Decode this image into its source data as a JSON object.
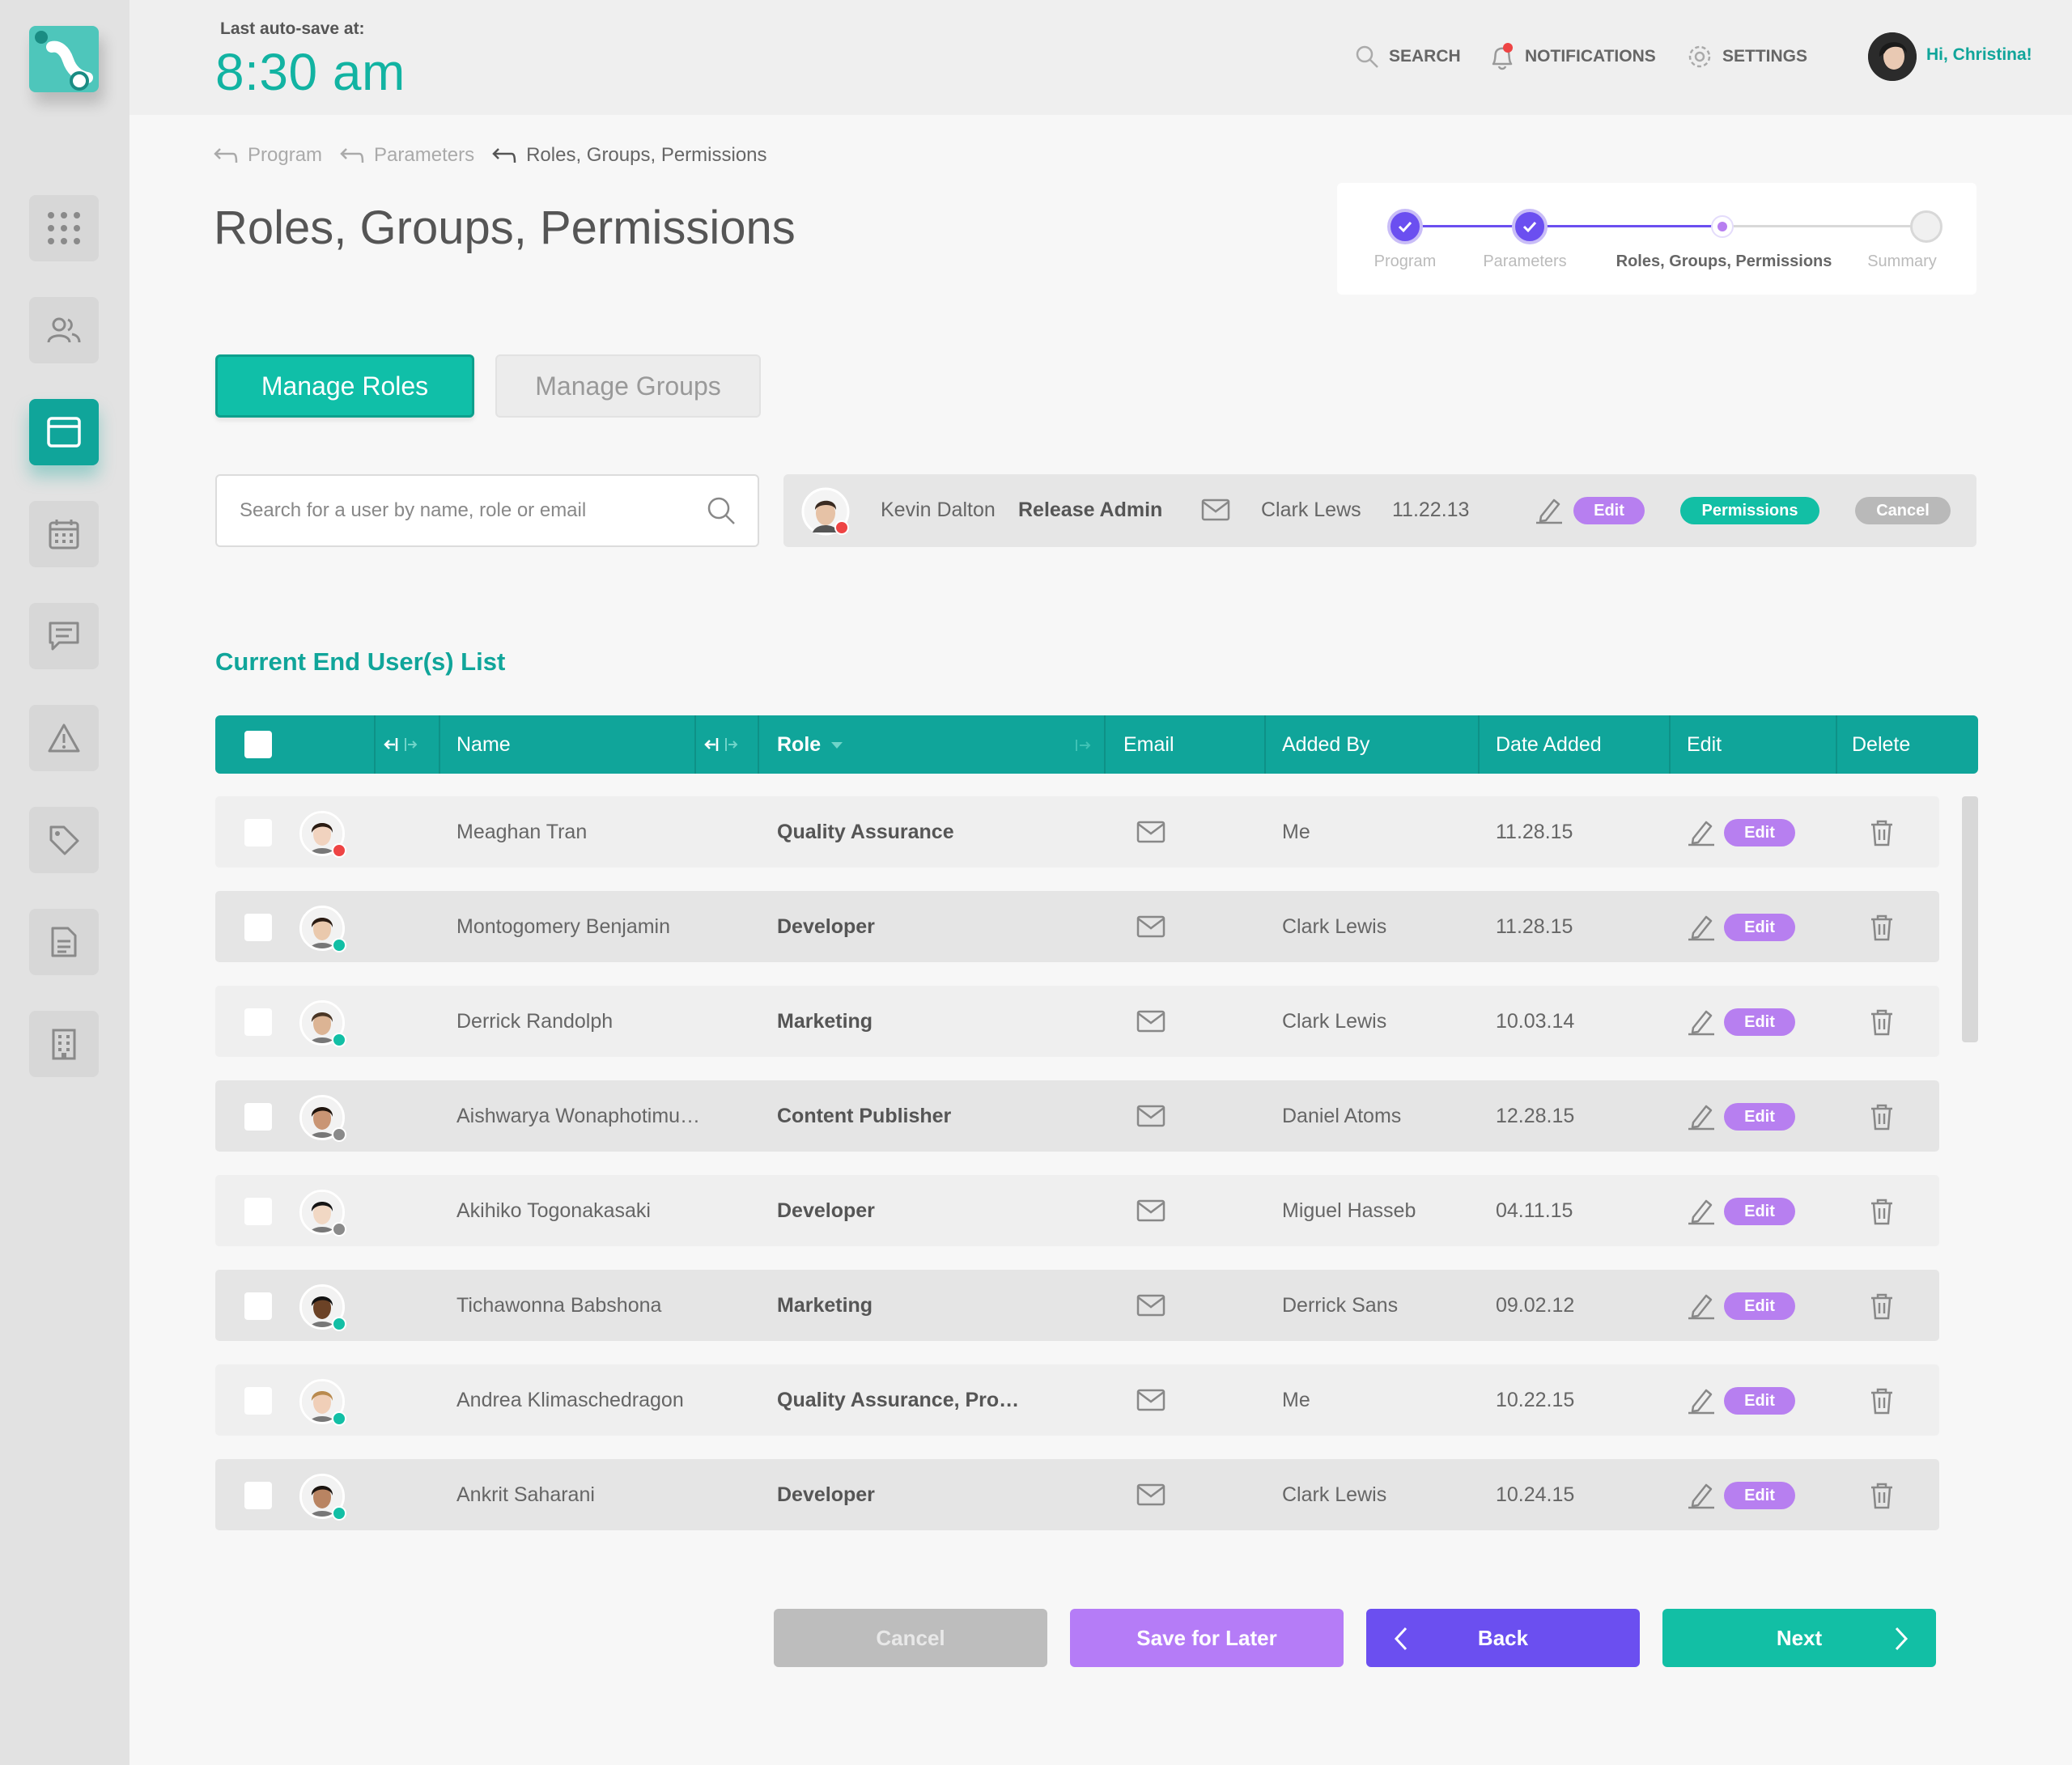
{
  "autosave": {
    "label": "Last auto-save at:",
    "time": "8:30 am"
  },
  "topnav": {
    "search": "SEARCH",
    "notifications": "NOTIFICATIONS",
    "settings": "SETTINGS",
    "greeting": "Hi, Christina!"
  },
  "sidebar": {
    "items": [
      {
        "icon": "grid-icon"
      },
      {
        "icon": "users-icon"
      },
      {
        "icon": "window-icon",
        "active": true
      },
      {
        "icon": "calendar-icon"
      },
      {
        "icon": "chat-icon"
      },
      {
        "icon": "warning-icon"
      },
      {
        "icon": "tag-icon"
      },
      {
        "icon": "document-icon"
      },
      {
        "icon": "building-icon"
      }
    ]
  },
  "breadcrumb": [
    "Program",
    "Parameters",
    "Roles, Groups, Permissions"
  ],
  "page_title": "Roles, Groups, Permissions",
  "stepper": {
    "steps": [
      "Program",
      "Parameters",
      "Roles, Groups, Permissions",
      "Summary"
    ],
    "current_index": 2
  },
  "tabs": {
    "active": "Manage Roles",
    "inactive": "Manage Groups"
  },
  "search": {
    "placeholder": "Search for a user by name, role or email"
  },
  "selected_user": {
    "name": "Kevin Dalton",
    "role": "Release Admin",
    "added_by": "Clark Lews",
    "date": "11.22.13",
    "edit_label": "Edit",
    "permissions_label": "Permissions",
    "cancel_label": "Cancel"
  },
  "section_title": "Current End User(s) List",
  "table": {
    "columns": [
      "Name",
      "Role",
      "Email",
      "Added By",
      "Date Added",
      "Edit",
      "Delete"
    ],
    "edit_label": "Edit",
    "rows": [
      {
        "name": "Meaghan Tran",
        "role": "Quality Assurance",
        "added_by": "Me",
        "date": "11.28.15",
        "status": "#ee4444"
      },
      {
        "name": "Montogomery Benjamin",
        "role": "Developer",
        "added_by": "Clark Lewis",
        "date": "11.28.15",
        "status": "#12bfa5"
      },
      {
        "name": "Derrick Randolph",
        "role": "Marketing",
        "added_by": "Clark Lewis",
        "date": "10.03.14",
        "status": "#12bfa5"
      },
      {
        "name": "Aishwarya Wonaphotimu…",
        "role": "Content Publisher",
        "added_by": "Daniel Atoms",
        "date": "12.28.15",
        "status": "#8a8a8a"
      },
      {
        "name": "Akihiko Togonakasaki",
        "role": "Developer",
        "added_by": "Miguel Hasseb",
        "date": "04.11.15",
        "status": "#8a8a8a"
      },
      {
        "name": "Tichawonna Babshona",
        "role": "Marketing",
        "added_by": "Derrick Sans",
        "date": "09.02.12",
        "status": "#12bfa5"
      },
      {
        "name": "Andrea Klimaschedragon",
        "role": "Quality Assurance, Pro…",
        "added_by": "Me",
        "date": "10.22.15",
        "status": "#12bfa5"
      },
      {
        "name": "Ankrit Saharani",
        "role": "Developer",
        "added_by": "Clark Lewis",
        "date": "10.24.15",
        "status": "#12bfa5"
      }
    ]
  },
  "footer": {
    "cancel": "Cancel",
    "save": "Save for Later",
    "back": "Back",
    "next": "Next"
  },
  "colors": {
    "brand_teal": "#10a59a",
    "accent_green": "#12bfa5",
    "purple": "#6b4ff0",
    "lavender": "#b77ff0",
    "alert_red": "#ee4444"
  }
}
